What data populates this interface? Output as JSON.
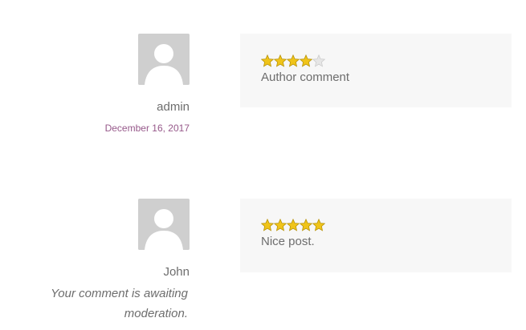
{
  "comments": [
    {
      "author": "admin",
      "date": "December 16, 2017",
      "rating": 4,
      "max_rating": 5,
      "text": "Author comment",
      "avatar_icon": "user-silhouette-icon"
    },
    {
      "author": "John",
      "moderation_note": "Your comment is awaiting moderation.",
      "rating": 5,
      "max_rating": 5,
      "text": "Nice post.",
      "avatar_icon": "user-silhouette-icon"
    }
  ],
  "colors": {
    "star_filled": "#f0c419",
    "star_empty": "#e6e6e6",
    "date_link": "#96588a",
    "avatar_bg": "#cfcfcf",
    "bubble_bg": "#f7f7f7"
  }
}
